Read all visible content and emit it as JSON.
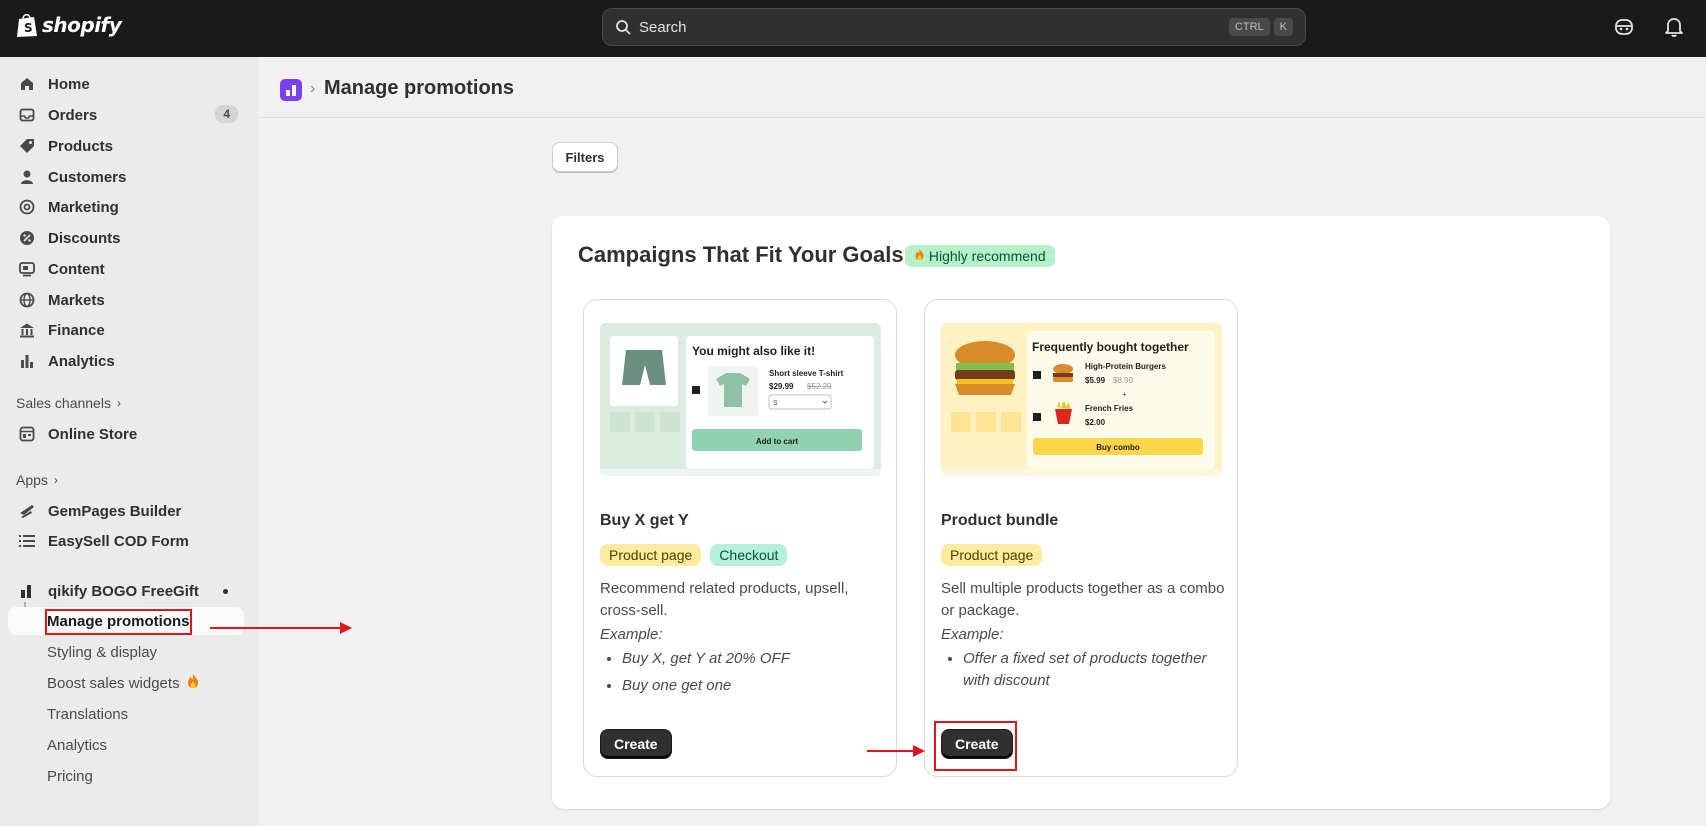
{
  "topbar": {
    "brand": "shopify",
    "search_placeholder": "Search",
    "shortcut_keys": [
      "CTRL",
      "K"
    ]
  },
  "sidebar": {
    "items": [
      {
        "label": "Home",
        "icon": "home-icon"
      },
      {
        "label": "Orders",
        "icon": "inbox-icon",
        "badge": "4"
      },
      {
        "label": "Products",
        "icon": "tag-icon"
      },
      {
        "label": "Customers",
        "icon": "person-icon"
      },
      {
        "label": "Marketing",
        "icon": "target-icon"
      },
      {
        "label": "Discounts",
        "icon": "discount-icon"
      },
      {
        "label": "Content",
        "icon": "content-icon"
      },
      {
        "label": "Markets",
        "icon": "globe-icon"
      },
      {
        "label": "Finance",
        "icon": "bank-icon"
      },
      {
        "label": "Analytics",
        "icon": "bar-chart-icon"
      }
    ],
    "sales_channels_label": "Sales channels",
    "online_store_label": "Online Store",
    "apps_label": "Apps",
    "apps": [
      {
        "label": "GemPages Builder",
        "icon": "gempages-icon"
      },
      {
        "label": "EasySell COD Form",
        "icon": "list-icon"
      }
    ],
    "active_app": {
      "label": "qikify BOGO FreeGift",
      "sub_items": [
        {
          "label": "Manage promotions",
          "active": true
        },
        {
          "label": "Styling & display"
        },
        {
          "label": "Boost sales widgets"
        },
        {
          "label": "Translations"
        },
        {
          "label": "Analytics"
        },
        {
          "label": "Pricing"
        }
      ]
    }
  },
  "header": {
    "title": "Manage promotions"
  },
  "filters_label": "Filters",
  "campaigns": {
    "title": "Campaigns That Fit Your Goals",
    "recommend_badge": "Highly recommend",
    "cards": [
      {
        "title": "Buy X get Y",
        "tags": [
          "Product page",
          "Checkout"
        ],
        "description": "Recommend related products, upsell, cross-sell.",
        "example_label": "Example:",
        "examples": [
          "Buy X, get Y at 20% OFF",
          "Buy one get one"
        ],
        "button": "Create",
        "illustration": {
          "headline": "You might also like it!",
          "product": "Short sleeve T-shirt",
          "price": "$29.99",
          "old_price": "$52.29",
          "size": "S",
          "cta": "Add to cart"
        }
      },
      {
        "title": "Product bundle",
        "tags": [
          "Product page"
        ],
        "description": "Sell multiple products together as a combo or package.",
        "example_label": "Example:",
        "examples": [
          "Offer a fixed set of products together with discount"
        ],
        "button": "Create",
        "illustration": {
          "headline": "Frequently bought together",
          "item1": "High-Protein Burgers",
          "item1_price": "$5.99",
          "item1_old_price": "$8.99",
          "plus": "+",
          "item2": "French Fries",
          "item2_price": "$2.00",
          "cta": "Buy combo"
        }
      }
    ]
  },
  "colors": {
    "topbar": "#1a1a1a",
    "annotation": "#e0141e",
    "app_icon": "#7b3ff2",
    "recommend_bg": "#b4f0c8"
  }
}
